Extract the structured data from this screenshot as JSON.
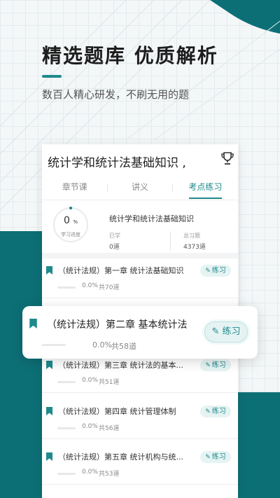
{
  "colors": {
    "accent": "#1f8a8c",
    "accent_light": "#e6f3f3",
    "dark_teal": "#0d6f76"
  },
  "hero": {
    "headline": "精选题库  优质解析",
    "subline": "数百人精心研发，不刷无用的题"
  },
  "card": {
    "title": "统计学和统计法基础知识 ,",
    "trophy_icon": "trophy-icon",
    "tabs": [
      {
        "label": "章节课",
        "active": false
      },
      {
        "label": "讲义",
        "active": false
      },
      {
        "label": "考点练习",
        "active": true
      }
    ],
    "summary": {
      "progress_value": "0",
      "progress_unit": "%",
      "progress_label": "学习进度",
      "title": "统计学和统计法基础知识",
      "learned_label": "已学",
      "learned_value": "0道",
      "total_label": "总习题",
      "total_value": "4373道"
    },
    "rows": [
      {
        "title": "（统计法规）第一章 统计法基础知识",
        "button": "练习",
        "percent": "0.0%",
        "count": "共70道",
        "progress": 0
      },
      {
        "title": "（统计法规）第三章 统计法的基本...",
        "button": "练习",
        "percent": "0.0%",
        "count": "共51道",
        "progress": 0
      },
      {
        "title": "（统计法规）第四章 统计管理体制",
        "button": "练习",
        "percent": "0.0%",
        "count": "共56道",
        "progress": 0
      },
      {
        "title": "（统计法规）第五章 统计机构与统...",
        "button": "练习",
        "percent": "0.0%",
        "count": "共53道",
        "progress": 0
      }
    ]
  },
  "floating_row": {
    "title": "（统计法规）第二章 基本统计法律...",
    "button": "练习",
    "percent": "0.0%",
    "count": "共58道",
    "progress": 0
  }
}
